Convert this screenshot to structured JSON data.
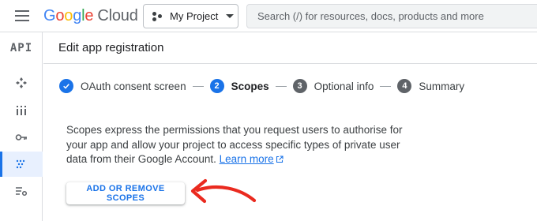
{
  "header": {
    "brand": {
      "g1": "G",
      "o1": "o",
      "o2": "o",
      "g2": "g",
      "l": "l",
      "e": "e",
      "product": "Cloud"
    },
    "project_picker_label": "My Project",
    "search_placeholder": "Search (/) for resources, docs, products and more"
  },
  "leftnav": {
    "logo_text": "API",
    "items": [
      {
        "icon": "api-diamond-icon"
      },
      {
        "icon": "library-icon"
      },
      {
        "icon": "key-icon"
      },
      {
        "icon": "consent-dots-icon",
        "active": true
      },
      {
        "icon": "settings-list-icon"
      }
    ]
  },
  "page": {
    "title": "Edit app registration",
    "steps": [
      {
        "number": "",
        "label": "OAuth consent screen",
        "state": "done"
      },
      {
        "number": "2",
        "label": "Scopes",
        "state": "current"
      },
      {
        "number": "3",
        "label": "Optional info",
        "state": "todo"
      },
      {
        "number": "4",
        "label": "Summary",
        "state": "todo"
      }
    ],
    "description": "Scopes express the permissions that you request users to authorise for your app and allow your project to access specific types of private user data from their Google Account.",
    "learn_more": "Learn more",
    "button_label": "ADD OR REMOVE SCOPES"
  },
  "colors": {
    "accent": "#1a73e8",
    "annotation_arrow": "#ea2a1f"
  }
}
